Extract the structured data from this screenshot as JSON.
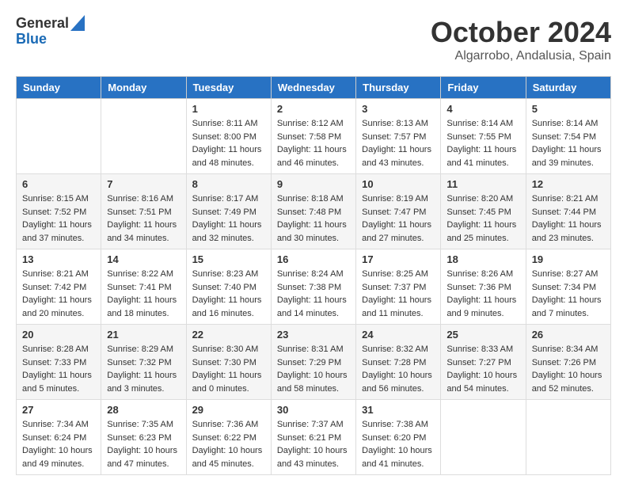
{
  "logo": {
    "general": "General",
    "blue": "Blue"
  },
  "header": {
    "month": "October 2024",
    "location": "Algarrobo, Andalusia, Spain"
  },
  "weekdays": [
    "Sunday",
    "Monday",
    "Tuesday",
    "Wednesday",
    "Thursday",
    "Friday",
    "Saturday"
  ],
  "weeks": [
    [
      {
        "day": "",
        "sunrise": "",
        "sunset": "",
        "daylight": ""
      },
      {
        "day": "",
        "sunrise": "",
        "sunset": "",
        "daylight": ""
      },
      {
        "day": "1",
        "sunrise": "Sunrise: 8:11 AM",
        "sunset": "Sunset: 8:00 PM",
        "daylight": "Daylight: 11 hours and 48 minutes."
      },
      {
        "day": "2",
        "sunrise": "Sunrise: 8:12 AM",
        "sunset": "Sunset: 7:58 PM",
        "daylight": "Daylight: 11 hours and 46 minutes."
      },
      {
        "day": "3",
        "sunrise": "Sunrise: 8:13 AM",
        "sunset": "Sunset: 7:57 PM",
        "daylight": "Daylight: 11 hours and 43 minutes."
      },
      {
        "day": "4",
        "sunrise": "Sunrise: 8:14 AM",
        "sunset": "Sunset: 7:55 PM",
        "daylight": "Daylight: 11 hours and 41 minutes."
      },
      {
        "day": "5",
        "sunrise": "Sunrise: 8:14 AM",
        "sunset": "Sunset: 7:54 PM",
        "daylight": "Daylight: 11 hours and 39 minutes."
      }
    ],
    [
      {
        "day": "6",
        "sunrise": "Sunrise: 8:15 AM",
        "sunset": "Sunset: 7:52 PM",
        "daylight": "Daylight: 11 hours and 37 minutes."
      },
      {
        "day": "7",
        "sunrise": "Sunrise: 8:16 AM",
        "sunset": "Sunset: 7:51 PM",
        "daylight": "Daylight: 11 hours and 34 minutes."
      },
      {
        "day": "8",
        "sunrise": "Sunrise: 8:17 AM",
        "sunset": "Sunset: 7:49 PM",
        "daylight": "Daylight: 11 hours and 32 minutes."
      },
      {
        "day": "9",
        "sunrise": "Sunrise: 8:18 AM",
        "sunset": "Sunset: 7:48 PM",
        "daylight": "Daylight: 11 hours and 30 minutes."
      },
      {
        "day": "10",
        "sunrise": "Sunrise: 8:19 AM",
        "sunset": "Sunset: 7:47 PM",
        "daylight": "Daylight: 11 hours and 27 minutes."
      },
      {
        "day": "11",
        "sunrise": "Sunrise: 8:20 AM",
        "sunset": "Sunset: 7:45 PM",
        "daylight": "Daylight: 11 hours and 25 minutes."
      },
      {
        "day": "12",
        "sunrise": "Sunrise: 8:21 AM",
        "sunset": "Sunset: 7:44 PM",
        "daylight": "Daylight: 11 hours and 23 minutes."
      }
    ],
    [
      {
        "day": "13",
        "sunrise": "Sunrise: 8:21 AM",
        "sunset": "Sunset: 7:42 PM",
        "daylight": "Daylight: 11 hours and 20 minutes."
      },
      {
        "day": "14",
        "sunrise": "Sunrise: 8:22 AM",
        "sunset": "Sunset: 7:41 PM",
        "daylight": "Daylight: 11 hours and 18 minutes."
      },
      {
        "day": "15",
        "sunrise": "Sunrise: 8:23 AM",
        "sunset": "Sunset: 7:40 PM",
        "daylight": "Daylight: 11 hours and 16 minutes."
      },
      {
        "day": "16",
        "sunrise": "Sunrise: 8:24 AM",
        "sunset": "Sunset: 7:38 PM",
        "daylight": "Daylight: 11 hours and 14 minutes."
      },
      {
        "day": "17",
        "sunrise": "Sunrise: 8:25 AM",
        "sunset": "Sunset: 7:37 PM",
        "daylight": "Daylight: 11 hours and 11 minutes."
      },
      {
        "day": "18",
        "sunrise": "Sunrise: 8:26 AM",
        "sunset": "Sunset: 7:36 PM",
        "daylight": "Daylight: 11 hours and 9 minutes."
      },
      {
        "day": "19",
        "sunrise": "Sunrise: 8:27 AM",
        "sunset": "Sunset: 7:34 PM",
        "daylight": "Daylight: 11 hours and 7 minutes."
      }
    ],
    [
      {
        "day": "20",
        "sunrise": "Sunrise: 8:28 AM",
        "sunset": "Sunset: 7:33 PM",
        "daylight": "Daylight: 11 hours and 5 minutes."
      },
      {
        "day": "21",
        "sunrise": "Sunrise: 8:29 AM",
        "sunset": "Sunset: 7:32 PM",
        "daylight": "Daylight: 11 hours and 3 minutes."
      },
      {
        "day": "22",
        "sunrise": "Sunrise: 8:30 AM",
        "sunset": "Sunset: 7:30 PM",
        "daylight": "Daylight: 11 hours and 0 minutes."
      },
      {
        "day": "23",
        "sunrise": "Sunrise: 8:31 AM",
        "sunset": "Sunset: 7:29 PM",
        "daylight": "Daylight: 10 hours and 58 minutes."
      },
      {
        "day": "24",
        "sunrise": "Sunrise: 8:32 AM",
        "sunset": "Sunset: 7:28 PM",
        "daylight": "Daylight: 10 hours and 56 minutes."
      },
      {
        "day": "25",
        "sunrise": "Sunrise: 8:33 AM",
        "sunset": "Sunset: 7:27 PM",
        "daylight": "Daylight: 10 hours and 54 minutes."
      },
      {
        "day": "26",
        "sunrise": "Sunrise: 8:34 AM",
        "sunset": "Sunset: 7:26 PM",
        "daylight": "Daylight: 10 hours and 52 minutes."
      }
    ],
    [
      {
        "day": "27",
        "sunrise": "Sunrise: 7:34 AM",
        "sunset": "Sunset: 6:24 PM",
        "daylight": "Daylight: 10 hours and 49 minutes."
      },
      {
        "day": "28",
        "sunrise": "Sunrise: 7:35 AM",
        "sunset": "Sunset: 6:23 PM",
        "daylight": "Daylight: 10 hours and 47 minutes."
      },
      {
        "day": "29",
        "sunrise": "Sunrise: 7:36 AM",
        "sunset": "Sunset: 6:22 PM",
        "daylight": "Daylight: 10 hours and 45 minutes."
      },
      {
        "day": "30",
        "sunrise": "Sunrise: 7:37 AM",
        "sunset": "Sunset: 6:21 PM",
        "daylight": "Daylight: 10 hours and 43 minutes."
      },
      {
        "day": "31",
        "sunrise": "Sunrise: 7:38 AM",
        "sunset": "Sunset: 6:20 PM",
        "daylight": "Daylight: 10 hours and 41 minutes."
      },
      {
        "day": "",
        "sunrise": "",
        "sunset": "",
        "daylight": ""
      },
      {
        "day": "",
        "sunrise": "",
        "sunset": "",
        "daylight": ""
      }
    ]
  ]
}
